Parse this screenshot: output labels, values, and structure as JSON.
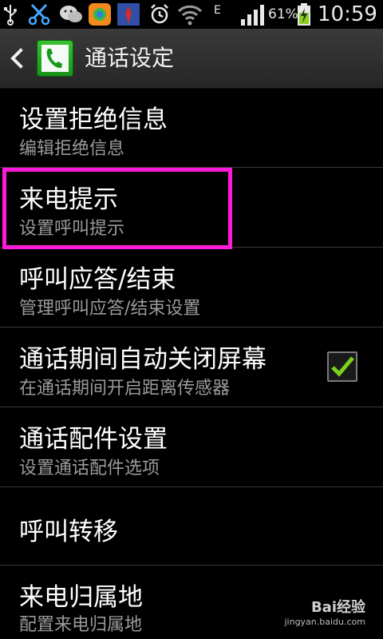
{
  "status_bar": {
    "network_label": "E",
    "battery_percent": "61%",
    "time": "10:59",
    "icons": [
      "usb-icon",
      "scissors-icon",
      "wechat-icon",
      "app-icon",
      "contact-icon",
      "alarm-icon",
      "wifi-icon",
      "signal-icon",
      "battery-charging-icon"
    ]
  },
  "action_bar": {
    "title": "通话设定",
    "back_icon": "chevron-left-icon",
    "app_icon": "phone-icon"
  },
  "settings": [
    {
      "title": "设置拒绝信息",
      "subtitle": "编辑拒绝信息"
    },
    {
      "title": "来电提示",
      "subtitle": "设置呼叫提示"
    },
    {
      "title": "呼叫应答/结束",
      "subtitle": "管理呼叫应答/结束设置"
    },
    {
      "title": "通话期间自动关闭屏幕",
      "subtitle": "在通话期间开启距离传感器",
      "checked": true
    },
    {
      "title": "通话配件设置",
      "subtitle": "设置通话配件选项"
    },
    {
      "title": "呼叫转移",
      "subtitle": ""
    },
    {
      "title": "来电归属地",
      "subtitle": "配置来电归属地"
    }
  ],
  "watermark": {
    "brand": "Bai经验",
    "url": "jingyan.baidu.com"
  },
  "colors": {
    "highlight": "#ff1ad9",
    "check": "#7bd11f",
    "phone_green": "#27ae27"
  }
}
